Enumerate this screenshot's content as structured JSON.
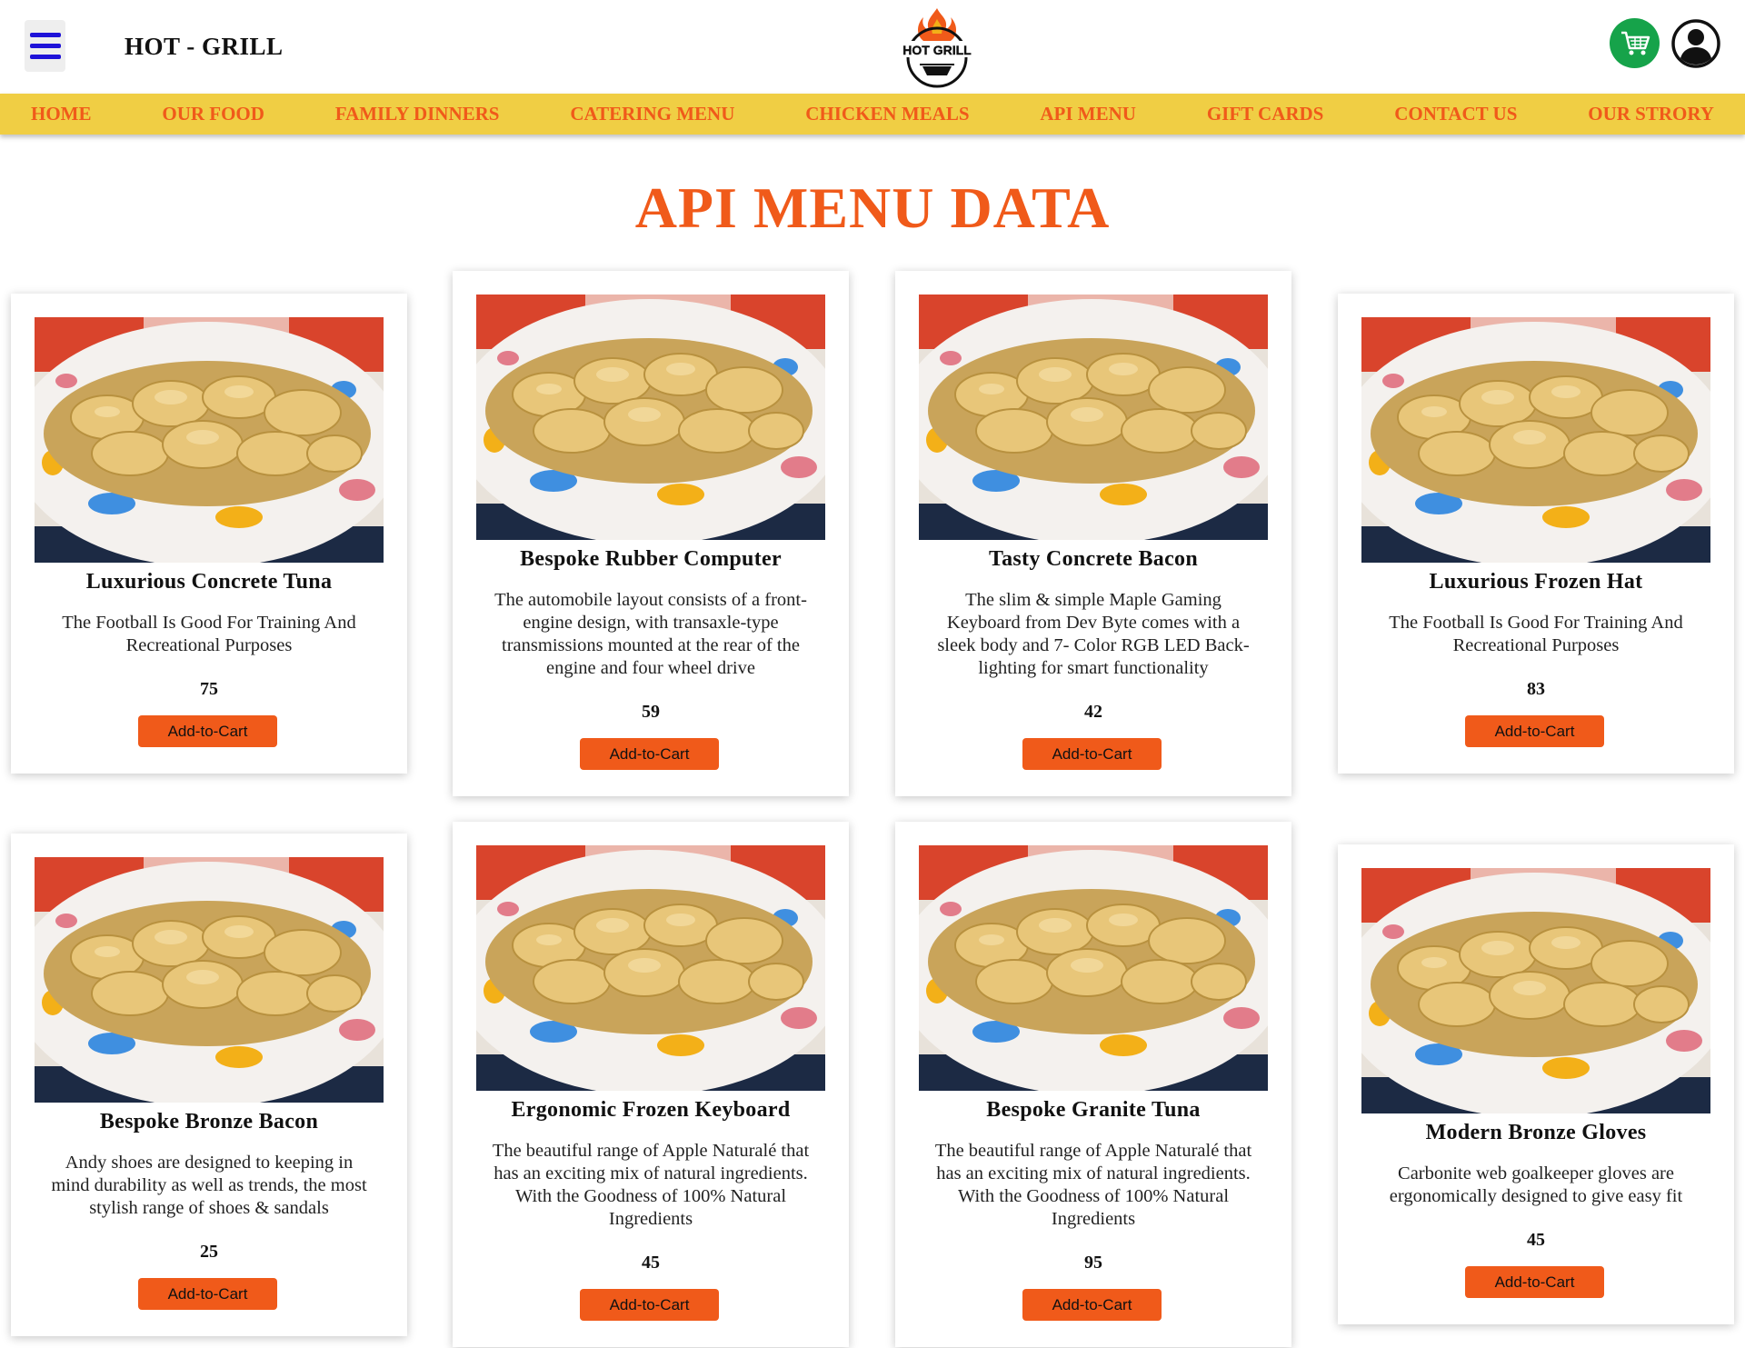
{
  "header": {
    "brand": "HOT - GRILL",
    "logo_text": "HOT GRILL"
  },
  "nav": {
    "items": [
      "HOME",
      "OUR FOOD",
      "FAMILY DINNERS",
      "CATERING MENU",
      "CHICKEN MEALS",
      "API MENU",
      "GIFT CARDS",
      "CONTACT US",
      "OUR STRORY"
    ]
  },
  "page": {
    "title": "API MENU DATA"
  },
  "cards": [
    {
      "title": "Luxurious Concrete Tuna",
      "desc": "The Football Is Good For Training And Recreational Purposes",
      "price": "75",
      "button": "Add-to-Cart"
    },
    {
      "title": "Bespoke Rubber Computer",
      "desc": "The automobile layout consists of a front-engine design, with transaxle-type transmissions mounted at the rear of the engine and four wheel drive",
      "price": "59",
      "button": "Add-to-Cart"
    },
    {
      "title": "Tasty Concrete Bacon",
      "desc": "The slim & simple Maple Gaming Keyboard from Dev Byte comes with a sleek body and 7- Color RGB LED Back-lighting for smart functionality",
      "price": "42",
      "button": "Add-to-Cart"
    },
    {
      "title": "Luxurious Frozen Hat",
      "desc": "The Football Is Good For Training And Recreational Purposes",
      "price": "83",
      "button": "Add-to-Cart"
    },
    {
      "title": "Bespoke Bronze Bacon",
      "desc": "Andy shoes are designed to keeping in mind durability as well as trends, the most stylish range of shoes & sandals",
      "price": "25",
      "button": "Add-to-Cart"
    },
    {
      "title": "Ergonomic Frozen Keyboard",
      "desc": "The beautiful range of Apple Naturalé that has an exciting mix of natural ingredients. With the Goodness of 100% Natural Ingredients",
      "price": "45",
      "button": "Add-to-Cart"
    },
    {
      "title": "Bespoke Granite Tuna",
      "desc": "The beautiful range of Apple Naturalé that has an exciting mix of natural ingredients. With the Goodness of 100% Natural Ingredients",
      "price": "95",
      "button": "Add-to-Cart"
    },
    {
      "title": "Modern Bronze Gloves",
      "desc": "Carbonite web goalkeeper gloves are ergonomically designed to give easy fit",
      "price": "45",
      "button": "Add-to-Cart"
    }
  ],
  "colors": {
    "accent": "#f05a1a",
    "nav_bg": "#f0ce44",
    "cart_bg": "#16a34a",
    "menu_icon": "#1e12d8"
  }
}
